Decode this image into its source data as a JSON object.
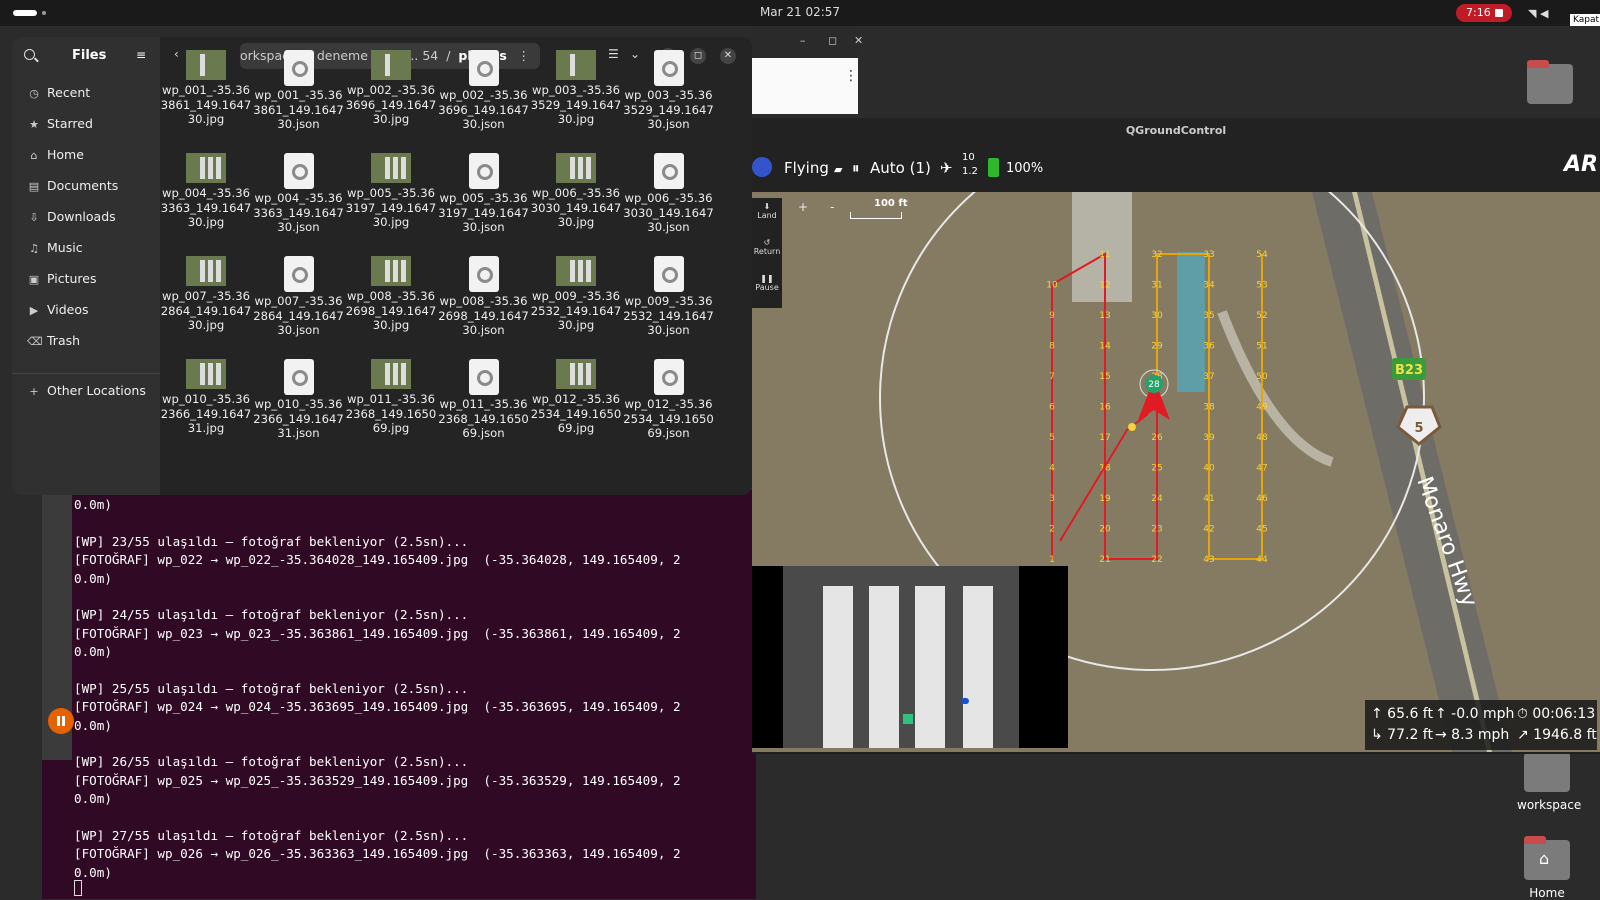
{
  "topbar": {
    "clock": "Mar 21  02:57",
    "record_time": "7:16",
    "close_tooltip": "Kapat"
  },
  "desktop": {
    "icon_workspace": "workspace",
    "icon_home": "Home"
  },
  "files": {
    "title": "Files",
    "sidebar": [
      "Recent",
      "Starred",
      "Home",
      "Documents",
      "Downloads",
      "Music",
      "Pictures",
      "Videos",
      "Trash"
    ],
    "other_locations": "Other Locations",
    "breadcrumb": {
      "p1": "orkspace",
      "p2": "deneme",
      "p3": "sur... 54",
      "p4": "photos"
    },
    "items": [
      {
        "n": "wp_001_-35.363861_149.164730.jpg",
        "t": "img"
      },
      {
        "n": "wp_001_-35.363861_149.164730.json",
        "t": "doc"
      },
      {
        "n": "wp_002_-35.363696_149.164730.jpg",
        "t": "img"
      },
      {
        "n": "wp_002_-35.363696_149.164730.json",
        "t": "doc"
      },
      {
        "n": "wp_003_-35.363529_149.164730.jpg",
        "t": "img"
      },
      {
        "n": "wp_003_-35.363529_149.164730.json",
        "t": "doc"
      },
      {
        "n": "wp_004_-35.363363_149.164730.jpg",
        "t": "img"
      },
      {
        "n": "wp_004_-35.363363_149.164730.json",
        "t": "doc"
      },
      {
        "n": "wp_005_-35.363197_149.164730.jpg",
        "t": "img"
      },
      {
        "n": "wp_005_-35.363197_149.164730.json",
        "t": "doc"
      },
      {
        "n": "wp_006_-35.363030_149.164730.jpg",
        "t": "img"
      },
      {
        "n": "wp_006_-35.363030_149.164730.json",
        "t": "doc"
      },
      {
        "n": "wp_007_-35.362864_149.164730.jpg",
        "t": "img"
      },
      {
        "n": "wp_007_-35.362864_149.164730.json",
        "t": "doc"
      },
      {
        "n": "wp_008_-35.362698_149.164730.jpg",
        "t": "img"
      },
      {
        "n": "wp_008_-35.362698_149.164730.json",
        "t": "doc"
      },
      {
        "n": "wp_009_-35.362532_149.164730.jpg",
        "t": "img"
      },
      {
        "n": "wp_009_-35.362532_149.164730.json",
        "t": "doc"
      },
      {
        "n": "wp_010_-35.362366_149.164731.jpg",
        "t": "img"
      },
      {
        "n": "wp_010_-35.362366_149.164731.json",
        "t": "doc"
      },
      {
        "n": "wp_011_-35.362368_149.165069.jpg",
        "t": "img"
      },
      {
        "n": "wp_011_-35.362368_149.165069.json",
        "t": "doc"
      },
      {
        "n": "wp_012_-35.362534_149.165069.jpg",
        "t": "img"
      },
      {
        "n": "wp_012_-35.362534_149.165069.json",
        "t": "doc"
      }
    ]
  },
  "terminal": {
    "lines": [
      "0.0m)",
      "",
      "[WP] 23/55 ulaşıldı — fotoğraf bekleniyor (2.5sn)...",
      "[FOTOĞRAF] wp_022 → wp_022_-35.364028_149.165409.jpg  (-35.364028, 149.165409, 2",
      "0.0m)",
      "",
      "[WP] 24/55 ulaşıldı — fotoğraf bekleniyor (2.5sn)...",
      "[FOTOĞRAF] wp_023 → wp_023_-35.363861_149.165409.jpg  (-35.363861, 149.165409, 2",
      "0.0m)",
      "",
      "[WP] 25/55 ulaşıldı — fotoğraf bekleniyor (2.5sn)...",
      "[FOTOĞRAF] wp_024 → wp_024_-35.363695_149.165409.jpg  (-35.363695, 149.165409, 2",
      "0.0m)",
      "",
      "[WP] 26/55 ulaşıldı — fotoğraf bekleniyor (2.5sn)...",
      "[FOTOĞRAF] wp_025 → wp_025_-35.363529_149.165409.jpg  (-35.363529, 149.165409, 2",
      "0.0m)",
      "",
      "[WP] 27/55 ulaşıldı — fotoğraf bekleniyor (2.5sn)...",
      "[FOTOĞRAF] wp_026 → wp_026_-35.363363_149.165409.jpg  (-35.363363, 149.165409, 2",
      "0.0m)"
    ]
  },
  "qgc": {
    "window_title": "QGroundControl",
    "flight_status": "Flying",
    "flight_mode": "Auto (1)",
    "gps_sats": "10",
    "gps_hdop": "1.2",
    "battery": "100%",
    "brand": "AR",
    "actions": {
      "land": "Land",
      "return": "Return",
      "pause": "Pause"
    },
    "zoom_in": "+",
    "zoom_out": "-",
    "scale": "100 ft",
    "road_name": "Monaro Hwy",
    "road_badge": "B23",
    "road_shield": "5",
    "current_wp": "28",
    "telemetry": {
      "altitude": "↑ 65.6 ft",
      "vertical_speed": "↑ -0.0 mph",
      "flight_time": "⏱ 00:06:13",
      "distance_home": "↳ 77.2 ft",
      "ground_speed": "→ 8.3 mph",
      "total_distance": "↗ 1946.8 ft"
    },
    "waypoints": [
      "1",
      "2",
      "3",
      "4",
      "5",
      "6",
      "7",
      "8",
      "9",
      "10",
      "11",
      "12",
      "13",
      "14",
      "15",
      "16",
      "17",
      "18",
      "19",
      "20",
      "21",
      "22",
      "23",
      "24",
      "25",
      "26",
      "27",
      "28",
      "29",
      "30",
      "31",
      "32",
      "33",
      "34",
      "35",
      "36",
      "37",
      "38",
      "39",
      "40",
      "41",
      "42",
      "43",
      "44",
      "45",
      "46",
      "47",
      "48",
      "49",
      "50",
      "51",
      "52",
      "53",
      "54"
    ]
  }
}
